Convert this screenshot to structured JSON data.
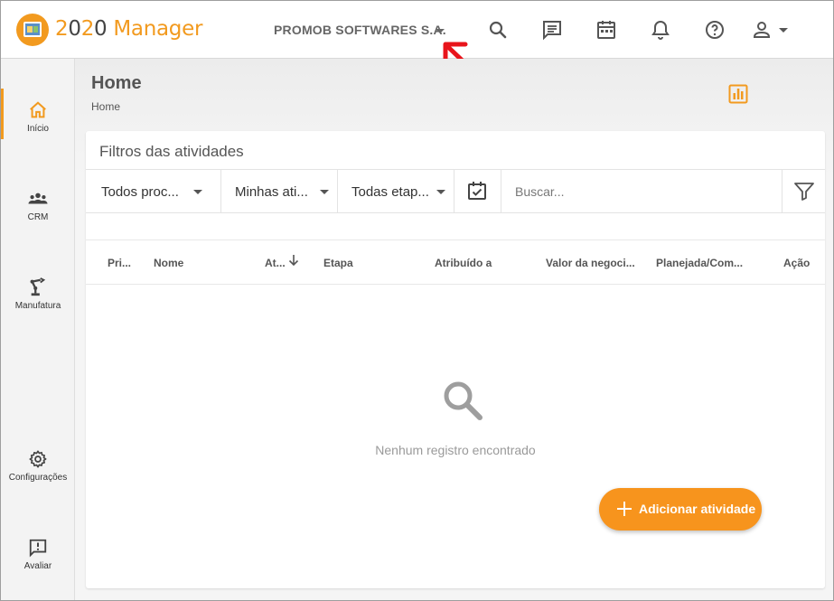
{
  "app": {
    "title_prefix": "2",
    "title_num": "020",
    "title_suffix": " Manager"
  },
  "header": {
    "company": "PROMOB SOFTWARES S.A.",
    "icons": [
      "search-icon",
      "chat-icon",
      "calendar-icon",
      "bell-icon",
      "help-icon",
      "user-icon"
    ]
  },
  "sidebar": {
    "items": [
      {
        "label": "Início",
        "icon": "home-icon",
        "active": true
      },
      {
        "label": "CRM",
        "icon": "people-icon"
      },
      {
        "label": "Manufatura",
        "icon": "robot-arm-icon"
      },
      {
        "label": "Configurações",
        "icon": "gear-icon"
      },
      {
        "label": "Avaliar",
        "icon": "feedback-icon"
      }
    ]
  },
  "page": {
    "title": "Home",
    "breadcrumb": "Home"
  },
  "filters": {
    "title": "Filtros das atividades",
    "process": "Todos proc...",
    "mine": "Minhas ati...",
    "stages": "Todas etap...",
    "search_placeholder": "Buscar..."
  },
  "table": {
    "columns": [
      "Pri...",
      "Nome",
      "At...",
      "Etapa",
      "Atribuído a",
      "Valor da negoci...",
      "Planejada/Com...",
      "Ação"
    ]
  },
  "empty_message": "Nenhum registro encontrado",
  "fab_label": "Adicionar atividade",
  "colors": {
    "accent": "#f7941d",
    "annotation": "#e8141b"
  }
}
